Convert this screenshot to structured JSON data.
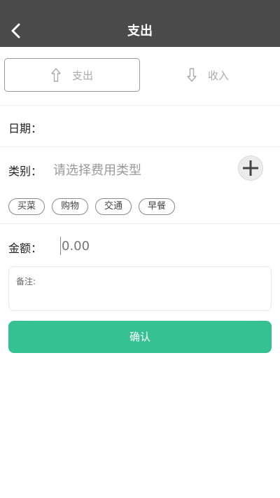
{
  "colors": {
    "navbar_bg": "#4a4a4a",
    "accent": "#35c191",
    "muted_text": "#999999"
  },
  "navbar": {
    "back_icon": "chevron-left-icon",
    "title": "支出"
  },
  "tabs": [
    {
      "label": "支出",
      "icon": "arrow-up-icon",
      "active": true
    },
    {
      "label": "收入",
      "icon": "arrow-down-icon",
      "active": false
    }
  ],
  "form": {
    "date_label": "日期：",
    "date_value": "",
    "category_label": "类别：",
    "category_placeholder": "请选择费用类型",
    "add_category_icon": "plus-circle-icon",
    "category_chips": [
      "买菜",
      "购物",
      "交通",
      "早餐"
    ],
    "amount_label": "金额：",
    "amount_placeholder": "0.00",
    "remark_label": "备注:",
    "remark_value": ""
  },
  "confirm_label": "确认"
}
